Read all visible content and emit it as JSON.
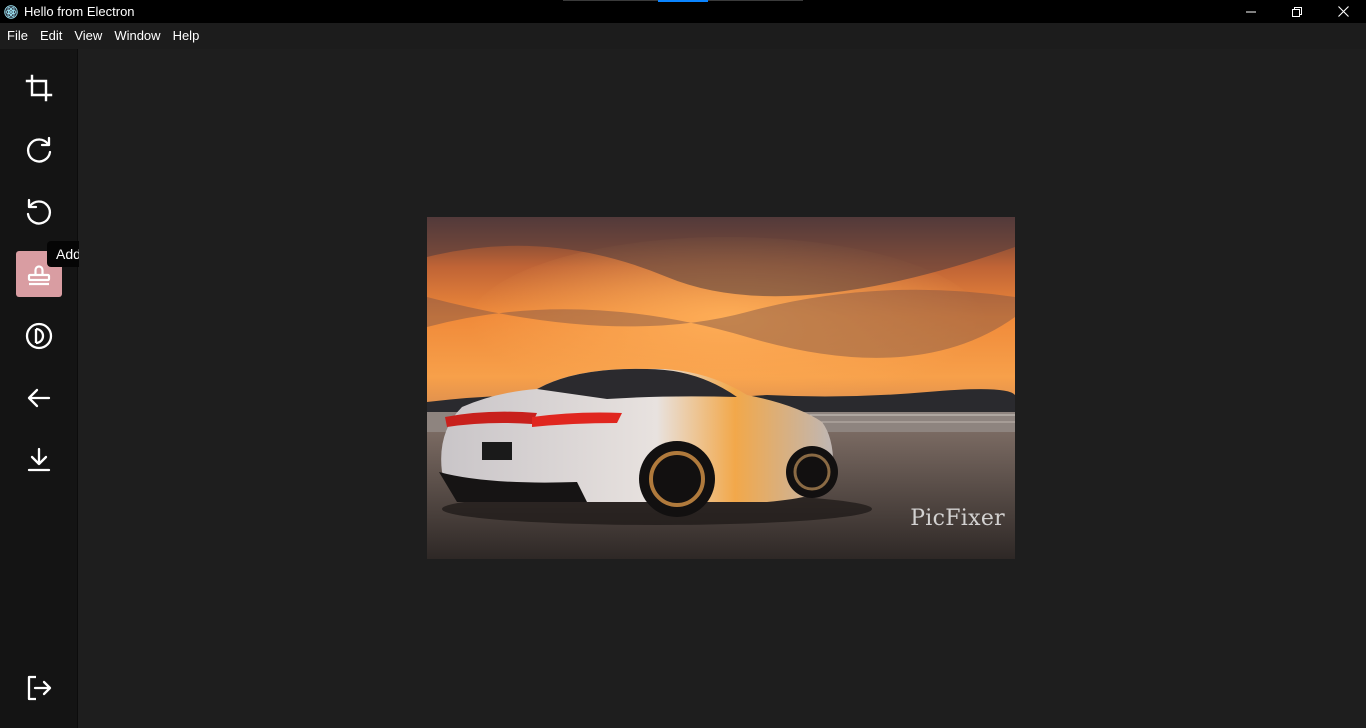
{
  "window": {
    "title": "Hello from Electron"
  },
  "menu": {
    "items": [
      "File",
      "Edit",
      "View",
      "Window",
      "Help"
    ]
  },
  "sidebar": {
    "tools": [
      {
        "name": "crop-icon",
        "label": "Crop"
      },
      {
        "name": "rotate-clockwise-icon",
        "label": "Rotate right"
      },
      {
        "name": "rotate-counterclockwise-icon",
        "label": "Rotate left"
      },
      {
        "name": "stamp-icon",
        "label": "Add watermark",
        "active": true
      },
      {
        "name": "contrast-icon",
        "label": "Filter"
      },
      {
        "name": "arrow-left-icon",
        "label": "Back"
      },
      {
        "name": "download-icon",
        "label": "Download"
      }
    ],
    "exit_icon": "logout-icon"
  },
  "tooltip": {
    "text": "Add watermark"
  },
  "image": {
    "watermark_text": "PicFixer",
    "alt": "white sports coupe at sunset"
  },
  "colors": {
    "active_tool": "#d99da2",
    "titlebar": "#000000",
    "background": "#1e1e1e"
  }
}
